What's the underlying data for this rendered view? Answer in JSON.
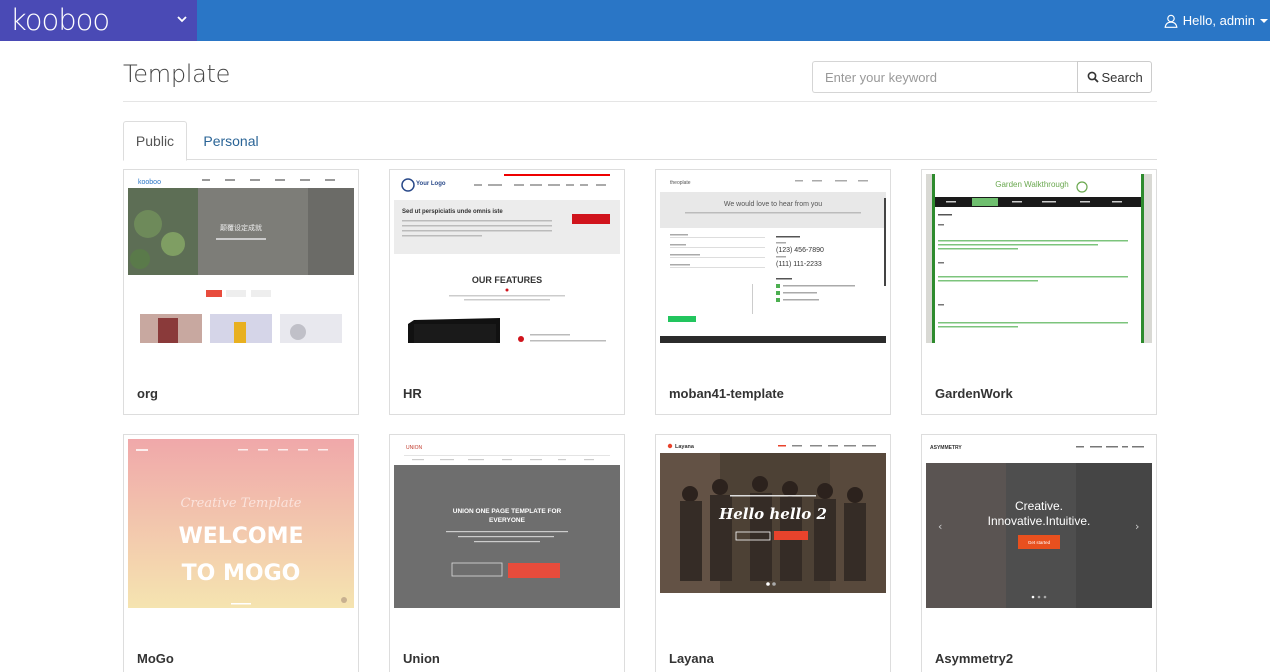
{
  "app": {
    "brand": "kooboo",
    "user_greeting": "Hello, admin"
  },
  "page": {
    "title": "Template"
  },
  "search": {
    "placeholder": "Enter your keyword",
    "button_label": "Search"
  },
  "tabs": [
    {
      "label": "Public",
      "active": true
    },
    {
      "label": "Personal",
      "active": false
    }
  ],
  "templates": [
    {
      "name": "org"
    },
    {
      "name": "HR"
    },
    {
      "name": "moban41-template"
    },
    {
      "name": "GardenWork"
    },
    {
      "name": "MoGo"
    },
    {
      "name": "Union"
    },
    {
      "name": "Layana"
    },
    {
      "name": "Asymmetry2"
    }
  ],
  "thumb_text": {
    "hr_logo": "Your Logo",
    "hr_heading": "Sed ut perspiciatis unde omnis iste",
    "hr_features": "OUR FEATURES",
    "moban_brand": "theoplate",
    "moban_heading": "We would love to hear from you",
    "moban_phone1": "(123) 456-7890",
    "moban_phone2": "(111) 111-2233",
    "garden_title": "Garden Walkthrough",
    "mogo_script": "Creative Template",
    "mogo_line1": "WELCOME",
    "mogo_line2": "TO MOGO",
    "union_brand": "UNION",
    "union_heading_1": "UNION ONE PAGE TEMPLATE FOR",
    "union_heading_2": "EVERYONE",
    "layana_brand": "Layana",
    "layana_script": "Hello hello 2",
    "asym_brand": "ASYMMETRY",
    "asym_line1": "Creative.",
    "asym_line2": "Innovative.Intuitive.",
    "asym_button": "Get started"
  },
  "colors": {
    "topbar": "#2a76c6",
    "brand_bg": "#4a4ab5",
    "link": "#2a6496"
  }
}
